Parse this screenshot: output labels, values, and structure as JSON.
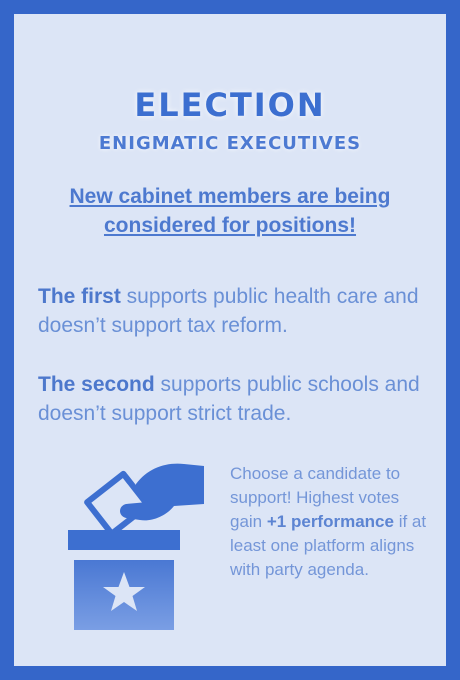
{
  "card": {
    "title": "ELECTION",
    "subtitle": "ENIGMATIC EXECUTIVES",
    "headline": "New cabinet members are being considered for positions!",
    "candidate1": {
      "lead": "The first",
      "rest": " supports public health care and doesn’t support tax reform."
    },
    "candidate2": {
      "lead": "The second",
      "rest": " supports public schools and doesn’t support strict trade."
    },
    "instructions": {
      "part1": "Choose a candidate to support! Highest votes gain ",
      "bold1": "+1 performance",
      "part2": " if at least one platform aligns with party agenda."
    },
    "icon": "ballot-box-voting-icon"
  },
  "colors": {
    "border": "#3566c9",
    "card": "#dce5f6",
    "accent": "#3c6fd0"
  }
}
